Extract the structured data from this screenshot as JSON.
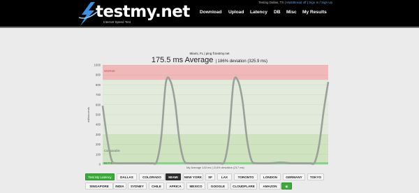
{
  "header": {
    "status_prefix": "Testing Dallas, TX",
    "multithread": "Multithread off",
    "sign_in": "Sign In",
    "sign_up": "Sign Up",
    "logo_text": "testmy.net",
    "logo_sub": "Internet Speed Test",
    "nav": [
      "Download",
      "Upload",
      "Latency",
      "DB",
      "Misc",
      "My Results"
    ]
  },
  "chart_data": {
    "type": "line",
    "supertitle": "Miami, FL | ping fl.testmy.net",
    "title": "175.5 ms Average",
    "subtitle": "| 186% deviation (325.9 ms)",
    "ylabel": "milliseconds",
    "ylim": [
      0,
      1000
    ],
    "yticks": [
      0,
      100,
      200,
      300,
      400,
      500,
      600,
      700,
      800,
      900,
      1000
    ],
    "bands": [
      {
        "label": "WORSE",
        "from": 850,
        "to": 1000,
        "color": "#f0b8b8"
      },
      {
        "label": "",
        "from": 300,
        "to": 850,
        "color": "#e2eadb"
      },
      {
        "label": "Comparable",
        "from": 0,
        "to": 300,
        "color": "#cfe3c1"
      }
    ],
    "bottom_label": "BETTER",
    "footer": "My Average 143 ms | 214% deviation (217 ms)",
    "series": [
      {
        "color": "#9aa19a",
        "x": [
          0,
          1,
          2,
          3,
          4,
          5,
          6,
          7,
          8,
          9,
          10,
          11,
          12,
          13,
          14,
          15,
          16,
          17,
          18,
          19,
          20,
          21,
          22,
          23,
          24,
          25,
          26,
          27,
          28,
          29,
          30,
          31,
          32,
          33,
          34,
          35,
          36,
          37,
          38,
          39,
          40,
          41,
          42,
          43,
          44,
          45,
          46,
          47,
          48,
          49,
          50
        ],
        "y": [
          590,
          260,
          40,
          12,
          10,
          10,
          10,
          10,
          10,
          10,
          10,
          10,
          30,
          280,
          820,
          840,
          640,
          250,
          40,
          12,
          10,
          10,
          10,
          10,
          10,
          10,
          12,
          30,
          280,
          820,
          840,
          640,
          250,
          40,
          12,
          10,
          10,
          10,
          14,
          18,
          18,
          14,
          10,
          10,
          10,
          10,
          10,
          20,
          200,
          540,
          830
        ]
      }
    ]
  },
  "buttons_row1": [
    "Test My Latency",
    "DALLAS",
    "COLORADO",
    "MIAMI",
    "NEW YORK",
    "SF",
    "LAX",
    "TORONTO",
    "LONDON",
    "GERMANY",
    "TOKYO"
  ],
  "buttons_row2": [
    "SINGAPORE",
    "INDIA",
    "SYDNEY",
    "CHILE",
    "AFRICA",
    "MEXICO",
    "GOOGLE",
    "CLOUDFLARE",
    "AMAZON"
  ],
  "selected_button": "MIAMI",
  "colors": {
    "header_bg": "#000000",
    "logo_blue": "#3b8fe6",
    "selected": "#2d2d2d",
    "green": "#3bab3b"
  }
}
